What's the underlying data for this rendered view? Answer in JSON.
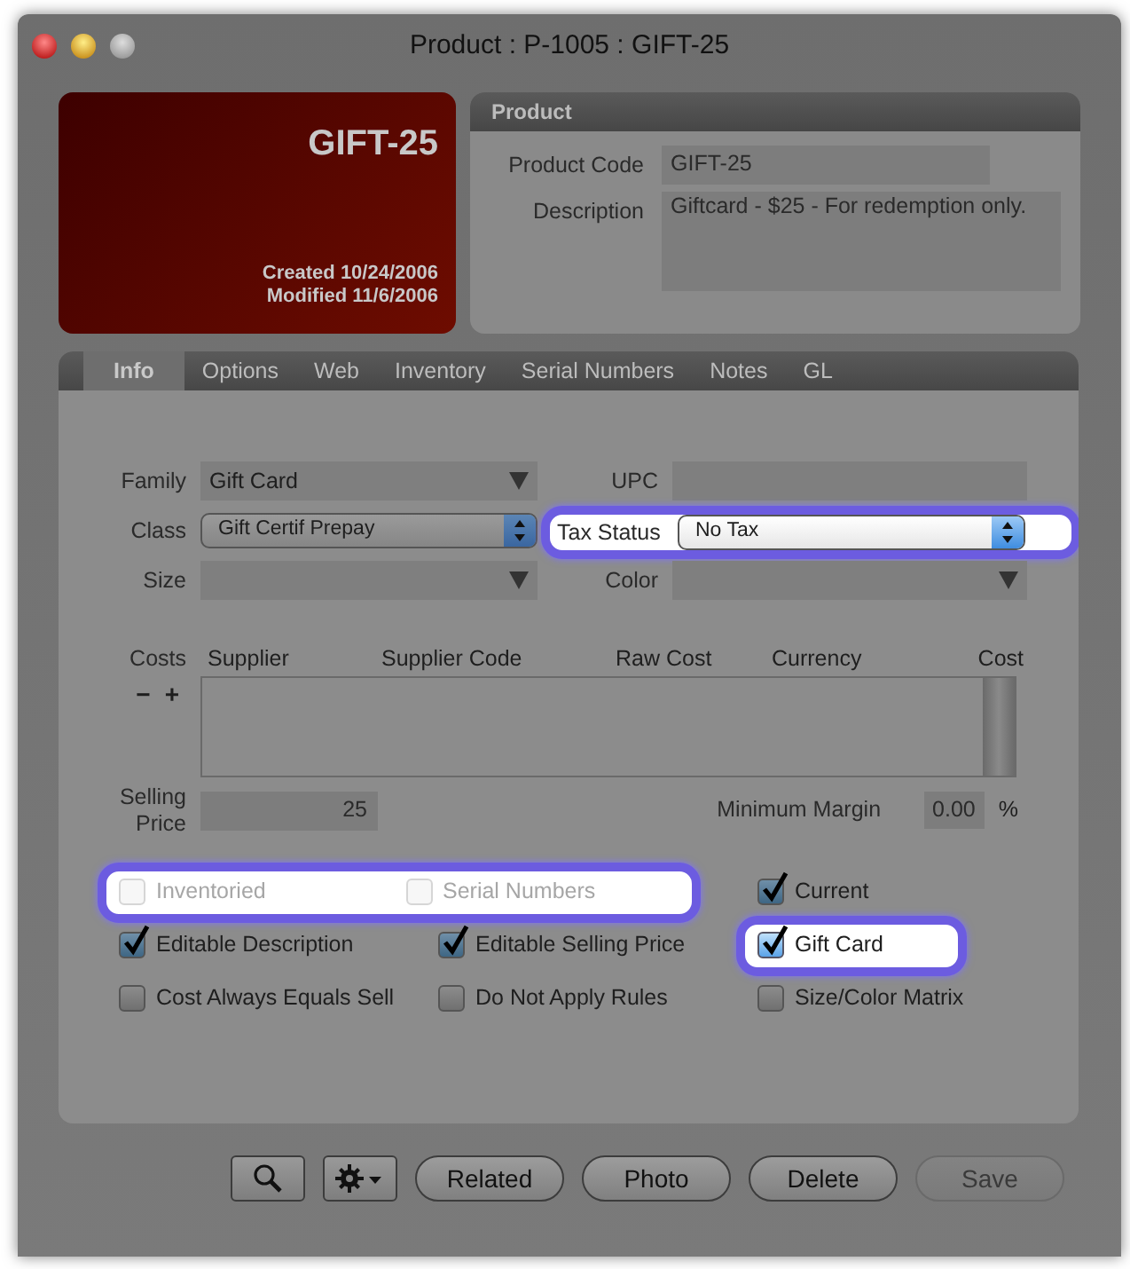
{
  "window": {
    "title": "Product : P-1005 : GIFT-25"
  },
  "summary": {
    "code": "GIFT-25",
    "created": "Created 10/24/2006",
    "modified": "Modified 11/6/2006"
  },
  "product_panel": {
    "title": "Product",
    "fields": [
      {
        "label": "Product Code",
        "value": "GIFT-25",
        "kind": "line"
      },
      {
        "label": "Description",
        "value": "Giftcard - $25 - For redemption only.",
        "kind": "area"
      }
    ]
  },
  "tabs": [
    {
      "label": "Info",
      "selected": true
    },
    {
      "label": "Options",
      "selected": false
    },
    {
      "label": "Web",
      "selected": false
    },
    {
      "label": "Inventory",
      "selected": false
    },
    {
      "label": "Serial Numbers",
      "selected": false
    },
    {
      "label": "Notes",
      "selected": false
    },
    {
      "label": "GL",
      "selected": false
    }
  ],
  "info_fields": [
    {
      "label": "Family",
      "value": "Gift Card",
      "kind": "combo",
      "highlighted": false
    },
    {
      "label": "UPC",
      "kind": "text",
      "highlighted": false
    },
    {
      "label": "Class",
      "value": "Gift Certif Prepay",
      "kind": "popup",
      "highlighted": false
    },
    {
      "label": "Tax Status",
      "value": "No Tax",
      "kind": "popup",
      "highlighted": true
    },
    {
      "label": "Size",
      "kind": "combo",
      "highlighted": false
    },
    {
      "label": "Color",
      "kind": "combo",
      "highlighted": false
    }
  ],
  "costs": {
    "label": "Costs",
    "remove": "−",
    "add": "+",
    "columns": [
      "Supplier",
      "Supplier Code",
      "Raw Cost",
      "Currency",
      "Cost"
    ]
  },
  "selling_price": {
    "label": "Selling Price",
    "value": "25"
  },
  "minimum_margin": {
    "label": "Minimum Margin",
    "value": "0.00",
    "unit": "%"
  },
  "checkbox_rows": [
    {
      "items": [
        {
          "label": "Inventoried",
          "checked": false,
          "disabled": true,
          "highlighted": true
        },
        {
          "label": "Serial Numbers",
          "checked": false,
          "disabled": true,
          "highlighted": true
        },
        {
          "label": "Current",
          "checked": true,
          "disabled": false,
          "highlighted": false
        }
      ]
    },
    {
      "items": [
        {
          "label": "Editable Description",
          "checked": true,
          "disabled": false,
          "highlighted": false
        },
        {
          "label": "Editable Selling Price",
          "checked": true,
          "disabled": false,
          "highlighted": false
        },
        {
          "label": "Gift Card",
          "checked": true,
          "disabled": false,
          "highlighted": true
        }
      ]
    },
    {
      "items": [
        {
          "label": "Cost Always Equals Sell",
          "checked": false,
          "disabled": false,
          "highlighted": false
        },
        {
          "label": "Do Not Apply Rules",
          "checked": false,
          "disabled": false,
          "highlighted": false
        },
        {
          "label": "Size/Color Matrix",
          "checked": false,
          "disabled": false,
          "highlighted": false
        }
      ]
    }
  ],
  "toolbar": [
    {
      "kind": "search"
    },
    {
      "kind": "gear"
    },
    {
      "kind": "push",
      "label": "Related",
      "disabled": false
    },
    {
      "kind": "push",
      "label": "Photo",
      "disabled": false
    },
    {
      "kind": "push",
      "label": "Delete",
      "disabled": false
    },
    {
      "kind": "push",
      "label": "Save",
      "disabled": true
    }
  ]
}
